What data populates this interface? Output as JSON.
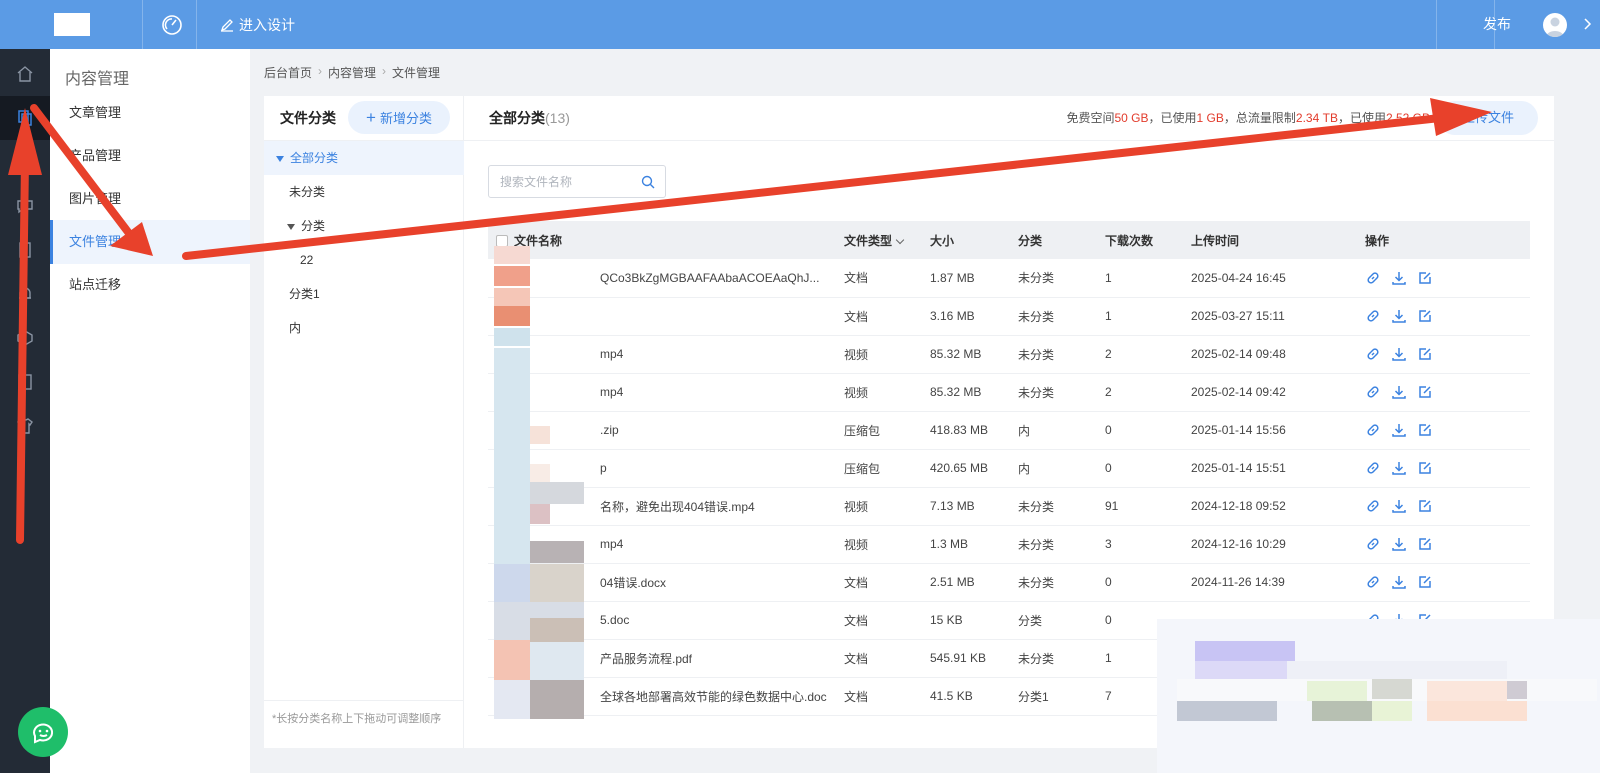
{
  "topbar": {
    "design_label": "进入设计",
    "publish_label": "发布"
  },
  "subnav": {
    "title": "内容管理",
    "items": [
      {
        "label": "文章管理"
      },
      {
        "label": "产品管理"
      },
      {
        "label": "图片管理"
      },
      {
        "label": "文件管理"
      },
      {
        "label": "站点迁移"
      }
    ]
  },
  "breadcrumb": [
    "后台首页",
    "内容管理",
    "文件管理"
  ],
  "categories": {
    "title": "文件分类",
    "add_label": "新增分类",
    "items": [
      {
        "label": "全部分类"
      },
      {
        "label": "未分类"
      },
      {
        "label": "分类"
      },
      {
        "label": "22"
      },
      {
        "label": "分类1"
      },
      {
        "label": "内"
      }
    ],
    "hint": "*长按分类名称上下拖动可调整顺序"
  },
  "main": {
    "heading": "全部分类",
    "count": "(13)",
    "quota": {
      "free_label": "免费空间",
      "free_value": "50 GB",
      "used_label": "，已使用",
      "used_value": "1 GB",
      "traffic_label": "，总流量限制",
      "traffic_value": "2.34 TB",
      "traffic_used_label": "，已使用",
      "traffic_used_value": "2.52 GB"
    },
    "upload_label": "上传文件",
    "search_placeholder": "搜索文件名称"
  },
  "table": {
    "headers": [
      "文件名称",
      "文件类型",
      "大小",
      "分类",
      "下载次数",
      "上传时间",
      "操作"
    ],
    "rows": [
      {
        "name": "QCo3BkZgMGBAAFAAbaACOEAaQhJ...",
        "type": "文档",
        "size": "1.87 MB",
        "category": "未分类",
        "downloads": "1",
        "time": "2025-04-24 16:45"
      },
      {
        "name": "",
        "type": "文档",
        "size": "3.16 MB",
        "category": "未分类",
        "downloads": "1",
        "time": "2025-03-27 15:11"
      },
      {
        "name": "mp4",
        "type": "视频",
        "size": "85.32 MB",
        "category": "未分类",
        "downloads": "2",
        "time": "2025-02-14 09:48"
      },
      {
        "name": "mp4",
        "type": "视频",
        "size": "85.32 MB",
        "category": "未分类",
        "downloads": "2",
        "time": "2025-02-14 09:42"
      },
      {
        "name": ".zip",
        "type": "压缩包",
        "size": "418.83 MB",
        "category": "内",
        "downloads": "0",
        "time": "2025-01-14 15:56"
      },
      {
        "name": "p",
        "type": "压缩包",
        "size": "420.65 MB",
        "category": "内",
        "downloads": "0",
        "time": "2025-01-14 15:51"
      },
      {
        "name": "名称，避免出现404错误.mp4",
        "type": "视频",
        "size": "7.13 MB",
        "category": "未分类",
        "downloads": "91",
        "time": "2024-12-18 09:52"
      },
      {
        "name": "mp4",
        "type": "视频",
        "size": "1.3 MB",
        "category": "未分类",
        "downloads": "3",
        "time": "2024-12-16 10:29"
      },
      {
        "name": "04错误.docx",
        "type": "文档",
        "size": "2.51 MB",
        "category": "未分类",
        "downloads": "0",
        "time": "2024-11-26 14:39"
      },
      {
        "name": "5.doc",
        "type": "文档",
        "size": "15 KB",
        "category": "分类",
        "downloads": "0",
        "time": ""
      },
      {
        "name": "产品服务流程.pdf",
        "type": "文档",
        "size": "545.91 KB",
        "category": "未分类",
        "downloads": "1",
        "time": ""
      },
      {
        "name": "全球各地部署高效节能的绿色数据中心.doc",
        "type": "文档",
        "size": "41.5 KB",
        "category": "分类1",
        "downloads": "7",
        "time": ""
      }
    ]
  },
  "colors": {
    "topbar": "#5b9be5",
    "accent": "#3b82e0",
    "rail": "#232b36",
    "annotation": "#e8412b",
    "quota_red": "#e23b2b"
  }
}
